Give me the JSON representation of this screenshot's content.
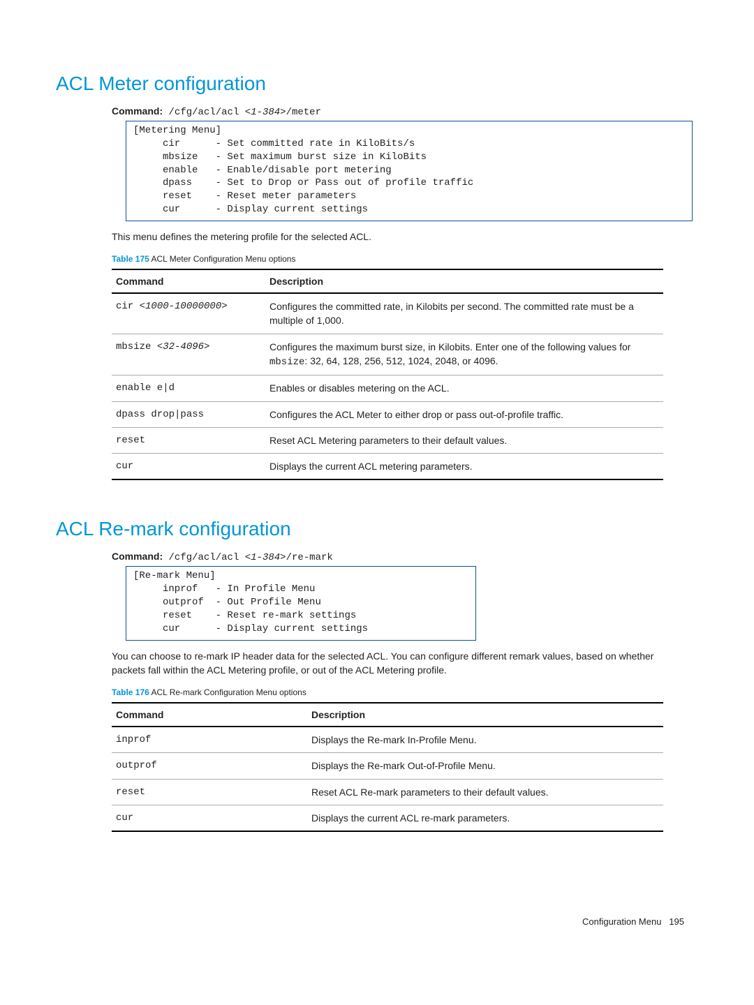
{
  "section1": {
    "title": "ACL Meter configuration",
    "cmd_label": "Command:",
    "cmd_path": " /cfg/acl/acl ",
    "cmd_arg": "<1-384>",
    "cmd_suffix": "/meter",
    "menu": "[Metering Menu]\n     cir      - Set committed rate in KiloBits/s\n     mbsize   - Set maximum burst size in KiloBits\n     enable   - Enable/disable port metering\n     dpass    - Set to Drop or Pass out of profile traffic\n     reset    - Reset meter parameters\n     cur      - Display current settings",
    "para": "This menu defines the metering profile for the selected ACL.",
    "table_label": "Table 175",
    "table_caption": "  ACL Meter Configuration Menu options",
    "col1": "Command",
    "col2": "Description",
    "rows": [
      {
        "cmd_pre": "cir ",
        "cmd_arg": "<1000-10000000>",
        "desc": "Configures the committed rate, in Kilobits per second. The committed rate must be a multiple of 1,000."
      },
      {
        "cmd_pre": "mbsize ",
        "cmd_arg": "<32-4096>",
        "desc_pre": "Configures the maximum burst size, in Kilobits. Enter one of the following values for ",
        "desc_code": "mbsize",
        "desc_post": ": 32, 64, 128, 256, 512, 1024, 2048, or 4096."
      },
      {
        "cmd_pre": "enable e|d",
        "cmd_arg": "",
        "desc": "Enables or disables metering on the ACL."
      },
      {
        "cmd_pre": "dpass drop|pass",
        "cmd_arg": "",
        "desc": "Configures the ACL Meter to either drop or pass out-of-profile traffic."
      },
      {
        "cmd_pre": "reset",
        "cmd_arg": "",
        "desc": "Reset ACL Metering parameters to their default values."
      },
      {
        "cmd_pre": "cur",
        "cmd_arg": "",
        "desc": "Displays the current ACL metering parameters."
      }
    ]
  },
  "section2": {
    "title": "ACL Re-mark configuration",
    "cmd_label": "Command:",
    "cmd_path": " /cfg/acl/acl ",
    "cmd_arg": "<1-384>",
    "cmd_suffix": "/re-mark",
    "menu": "[Re-mark Menu]\n     inprof   - In Profile Menu\n     outprof  - Out Profile Menu\n     reset    - Reset re-mark settings\n     cur      - Display current settings",
    "para": "You can choose to re-mark IP header data for the selected ACL. You can configure different remark values, based on whether packets fall within the ACL Metering profile, or out of the ACL Metering profile.",
    "table_label": "Table 176",
    "table_caption": "  ACL Re-mark Configuration Menu options",
    "col1": "Command",
    "col2": "Description",
    "rows": [
      {
        "cmd": "inprof",
        "desc": "Displays the Re-mark In-Profile Menu."
      },
      {
        "cmd": "outprof",
        "desc": "Displays the Re-mark Out-of-Profile Menu."
      },
      {
        "cmd": "reset",
        "desc": "Reset ACL Re-mark parameters to their default values."
      },
      {
        "cmd": "cur",
        "desc": "Displays the current ACL re-mark parameters."
      }
    ]
  },
  "footer": {
    "label": "Configuration Menu",
    "page": "195"
  }
}
